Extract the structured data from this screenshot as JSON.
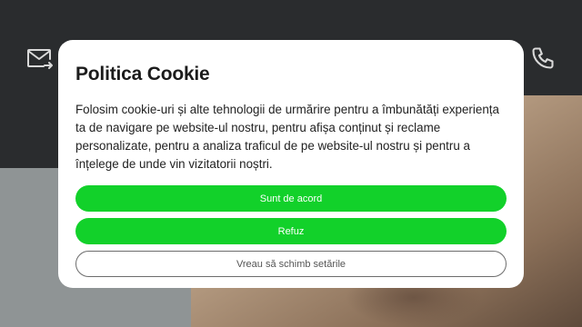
{
  "header": {
    "mail_icon": "mail-forward-icon",
    "phone_icon": "phone-icon"
  },
  "cookie_modal": {
    "title": "Politica Cookie",
    "body": "Folosim cookie-uri și alte tehnologii de urmărire pentru a îmbunătăți experiența ta de navigare pe website-ul nostru, pentru afișa conținut și reclame personalizate, pentru a analiza traficul de pe website-ul nostru și pentru a înțelege de unde vin vizitatorii noștri.",
    "accept_label": "Sunt de acord",
    "refuse_label": "Refuz",
    "settings_label": "Vreau să schimb setările"
  },
  "colors": {
    "accent_green": "#12d12a",
    "header_bg": "#2a2c2e"
  }
}
